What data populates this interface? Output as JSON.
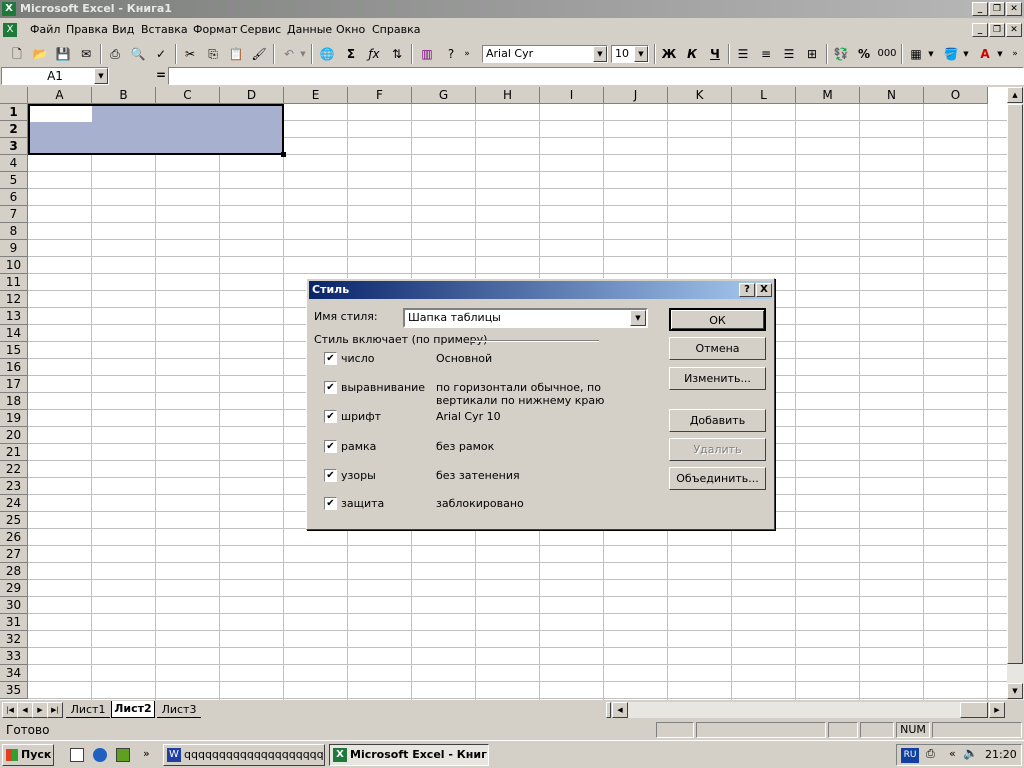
{
  "app": {
    "title": "Microsoft Excel - Книга1",
    "icon": "excel-icon"
  },
  "menu": [
    "Файл",
    "Правка",
    "Вид",
    "Вставка",
    "Формат",
    "Сервис",
    "Данные",
    "Окно",
    "Справка"
  ],
  "toolbar": {
    "font_name": "Arial Cyr",
    "font_size": "10",
    "bold": "Ж",
    "italic": "К",
    "underline": "Ч",
    "percent": "%",
    "thousands": "000"
  },
  "formula_bar": {
    "name_box": "A1",
    "equals": "="
  },
  "sheet": {
    "columns": [
      "A",
      "B",
      "C",
      "D",
      "E",
      "F",
      "G",
      "H",
      "I",
      "J",
      "K",
      "L",
      "M",
      "N",
      "O"
    ],
    "rows": [
      "1",
      "2",
      "3",
      "4",
      "5",
      "6",
      "7",
      "8",
      "9",
      "10",
      "11",
      "12",
      "13",
      "14",
      "15",
      "16",
      "17",
      "18",
      "19",
      "20",
      "21",
      "22",
      "23",
      "24",
      "25",
      "26",
      "27",
      "28",
      "29",
      "30",
      "31",
      "32",
      "33",
      "34",
      "35"
    ],
    "tabs": [
      "Лист1",
      "Лист2",
      "Лист3"
    ],
    "active_tab": "Лист2"
  },
  "status": {
    "ready": "Готово",
    "num": "NUM"
  },
  "taskbar": {
    "start": "Пуск",
    "tasks": [
      "qqqqqqqqqqqqqqqqqqqq...",
      "Microsoft Excel - Книг..."
    ],
    "lang": "RU",
    "clock": "21:20",
    "chevron": "«"
  },
  "dialog": {
    "title": "Стиль",
    "help": "?",
    "close": "X",
    "style_name_label": "Имя стиля:",
    "style_name_value": "Шапка таблицы",
    "includes_label": "Стиль включает (по примеру)",
    "items": [
      {
        "label": "число",
        "value": "Основной",
        "checked": true
      },
      {
        "label": "выравнивание",
        "value": "по горизонтали обычное, по вертикали по нижнему краю",
        "checked": true
      },
      {
        "label": "шрифт",
        "value": "Arial Cyr 10",
        "checked": true
      },
      {
        "label": "рамка",
        "value": "без рамок",
        "checked": true
      },
      {
        "label": "узоры",
        "value": "без затенения",
        "checked": true
      },
      {
        "label": "защита",
        "value": "заблокировано",
        "checked": true
      }
    ],
    "buttons": [
      "ОК",
      "Отмена",
      "Изменить...",
      "Добавить",
      "Удалить",
      "Объединить..."
    ]
  },
  "colors": {
    "selection": "#a8b0d0",
    "dialog_title_start": "#0a246a",
    "dialog_title_end": "#a6caf0"
  }
}
